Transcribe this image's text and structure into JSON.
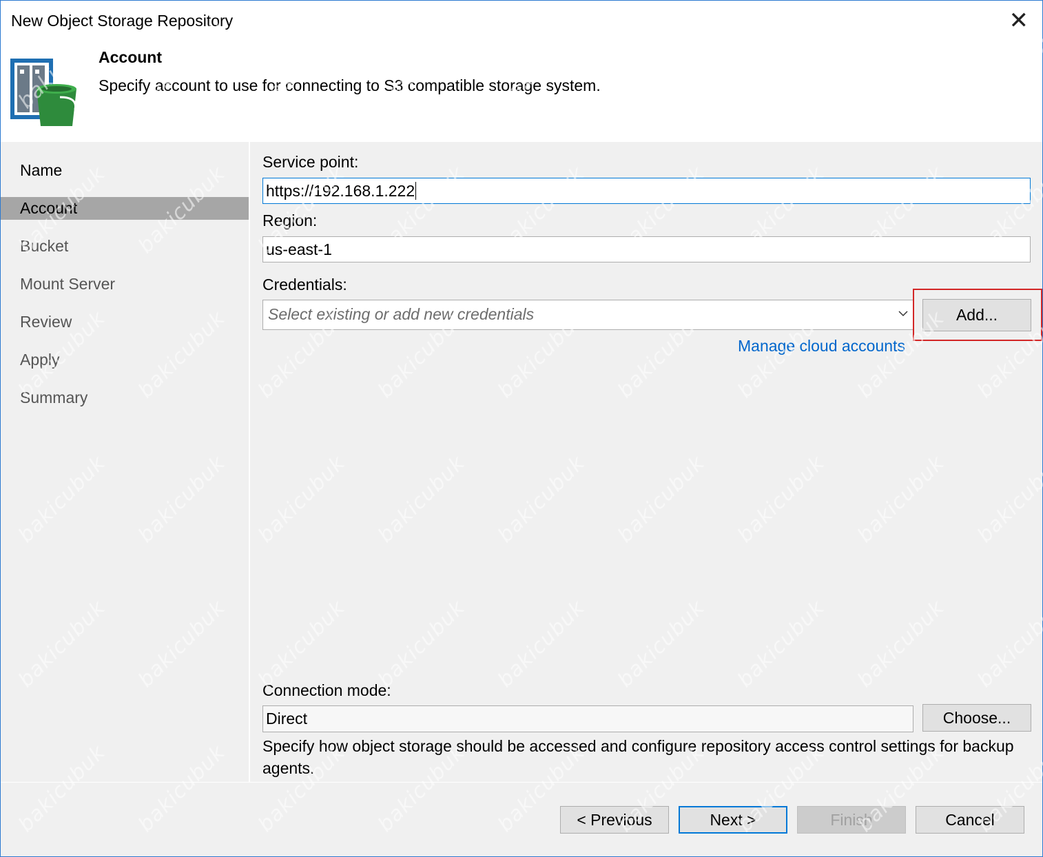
{
  "window": {
    "title": "New Object Storage Repository",
    "close_glyph": "✕"
  },
  "header": {
    "step_title": "Account",
    "step_description": "Specify account to use for connecting to S3 compatible storage system."
  },
  "sidebar": {
    "items": [
      {
        "label": "Name"
      },
      {
        "label": "Account"
      },
      {
        "label": "Bucket"
      },
      {
        "label": "Mount Server"
      },
      {
        "label": "Review"
      },
      {
        "label": "Apply"
      },
      {
        "label": "Summary"
      }
    ],
    "active_item": "Account"
  },
  "form": {
    "service_point_label": "Service point:",
    "service_point_value": "https://192.168.1.222",
    "region_label": "Region:",
    "region_value": "us-east-1",
    "credentials_label": "Credentials:",
    "credentials_placeholder": "Select existing or add new credentials",
    "add_button": "Add...",
    "manage_link": "Manage cloud accounts",
    "connection_mode_label": "Connection mode:",
    "connection_mode_value": "Direct",
    "choose_button": "Choose...",
    "connection_mode_help": "Specify how object storage should be accessed and configure repository access control settings for backup agents."
  },
  "footer": {
    "previous_button": "< Previous",
    "next_button": "Next >",
    "finish_button": "Finish",
    "cancel_button": "Cancel"
  },
  "watermark_text": "bakicubuk",
  "colors": {
    "accent": "#0078d7",
    "highlight": "#d32626",
    "link": "#0066cc",
    "active_nav": "#a6a6a6"
  }
}
